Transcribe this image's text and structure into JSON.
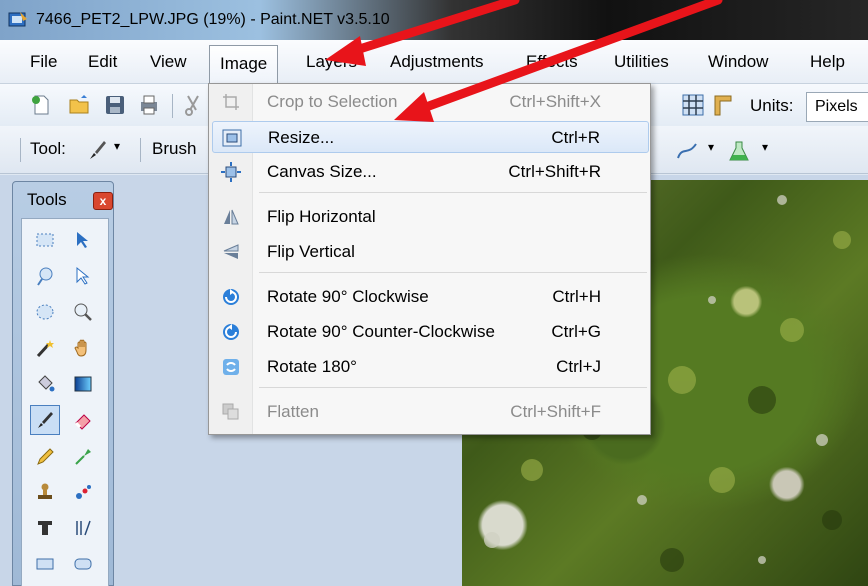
{
  "window": {
    "title": "7466_PET2_LPW.JPG (19%) - Paint.NET v3.5.10"
  },
  "menubar": {
    "items": [
      {
        "label": "File"
      },
      {
        "label": "Edit"
      },
      {
        "label": "View"
      },
      {
        "label": "Image"
      },
      {
        "label": "Layers"
      },
      {
        "label": "Adjustments"
      },
      {
        "label": "Effects"
      },
      {
        "label": "Utilities"
      },
      {
        "label": "Window"
      },
      {
        "label": "Help"
      }
    ],
    "active": "Image"
  },
  "toolbar": {
    "units_label": "Units:",
    "units_value": "Pixels",
    "tool_label": "Tool:",
    "brush_label": "Brush"
  },
  "tools_panel": {
    "title": "Tools",
    "close": "x"
  },
  "image_menu": {
    "items": [
      {
        "label": "Crop to Selection",
        "shortcut": "Ctrl+Shift+X",
        "enabled": false,
        "icon": "crop-icon"
      },
      {
        "label": "Resize...",
        "shortcut": "Ctrl+R",
        "enabled": true,
        "highlighted": true,
        "icon": "resize-icon"
      },
      {
        "label": "Canvas Size...",
        "shortcut": "Ctrl+Shift+R",
        "enabled": true,
        "icon": "canvas-size-icon"
      },
      {
        "label": "Flip Horizontal",
        "shortcut": "",
        "enabled": true,
        "icon": "flip-horizontal-icon"
      },
      {
        "label": "Flip Vertical",
        "shortcut": "",
        "enabled": true,
        "icon": "flip-vertical-icon"
      },
      {
        "label": "Rotate 90° Clockwise",
        "shortcut": "Ctrl+H",
        "enabled": true,
        "icon": "rotate-cw-icon"
      },
      {
        "label": "Rotate 90° Counter-Clockwise",
        "shortcut": "Ctrl+G",
        "enabled": true,
        "icon": "rotate-ccw-icon"
      },
      {
        "label": "Rotate 180°",
        "shortcut": "Ctrl+J",
        "enabled": true,
        "icon": "rotate-180-icon"
      },
      {
        "label": "Flatten",
        "shortcut": "Ctrl+Shift+F",
        "enabled": false,
        "icon": "flatten-icon"
      }
    ]
  },
  "colors": {
    "annotation_arrow": "#e8141a",
    "highlight": "#dbe8f8",
    "disabled_text": "#8b8b8b"
  }
}
